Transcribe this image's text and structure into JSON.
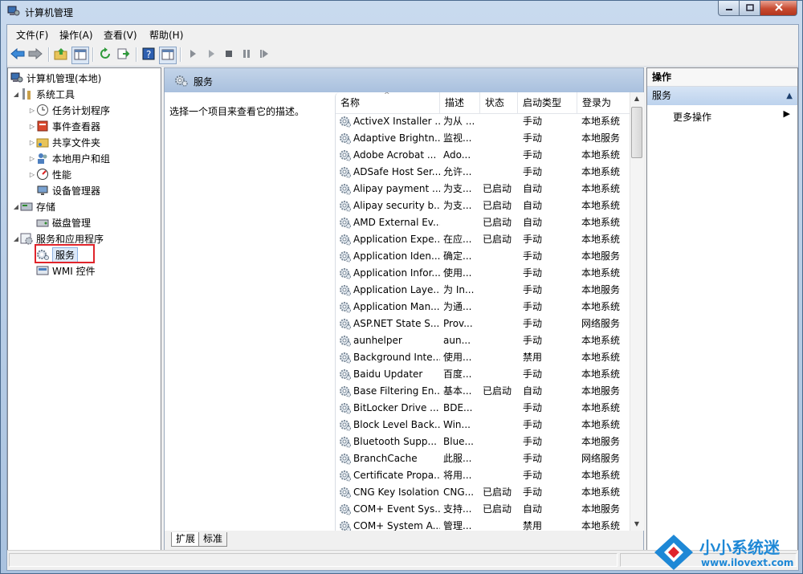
{
  "window": {
    "title": "计算机管理",
    "controls": {
      "minimize": "minimize-icon",
      "maximize": "maximize-icon",
      "close": "close-icon"
    }
  },
  "menubar": [
    "文件(F)",
    "操作(A)",
    "查看(V)",
    "帮助(H)"
  ],
  "toolbar": [
    "back-icon",
    "forward-icon",
    "up-folder-icon",
    "show-hide-tree-icon",
    "refresh-icon",
    "export-icon",
    "help-icon",
    "properties-icon",
    "play-icon",
    "play-outline-icon",
    "stop-icon",
    "pause-icon",
    "restart-icon"
  ],
  "tree": {
    "root": "计算机管理(本地)",
    "items": [
      {
        "label": "系统工具",
        "level": 1,
        "expanded": true,
        "icon": "tools-icon"
      },
      {
        "label": "任务计划程序",
        "level": 2,
        "icon": "clock-icon"
      },
      {
        "label": "事件查看器",
        "level": 2,
        "icon": "event-log-icon"
      },
      {
        "label": "共享文件夹",
        "level": 2,
        "icon": "shared-folder-icon"
      },
      {
        "label": "本地用户和组",
        "level": 2,
        "icon": "users-icon"
      },
      {
        "label": "性能",
        "level": 2,
        "icon": "performance-icon"
      },
      {
        "label": "设备管理器",
        "level": 2,
        "icon": "device-manager-icon"
      },
      {
        "label": "存储",
        "level": 1,
        "expanded": true,
        "icon": "storage-icon"
      },
      {
        "label": "磁盘管理",
        "level": 2,
        "icon": "disk-icon"
      },
      {
        "label": "服务和应用程序",
        "level": 1,
        "expanded": true,
        "icon": "services-apps-icon"
      },
      {
        "label": "服务",
        "level": 2,
        "selected": true,
        "icon": "service-gear-icon"
      },
      {
        "label": "WMI 控件",
        "level": 2,
        "icon": "wmi-icon"
      }
    ]
  },
  "services_panel": {
    "title": "服务",
    "description_hint": "选择一个项目来查看它的描述。",
    "columns": [
      "名称",
      "描述",
      "状态",
      "启动类型",
      "登录为"
    ],
    "rows": [
      [
        "ActiveX Installer ...",
        "为从 ...",
        "",
        "手动",
        "本地系统"
      ],
      [
        "Adaptive Brightn...",
        "监视...",
        "",
        "手动",
        "本地服务"
      ],
      [
        "Adobe Acrobat ...",
        "Ado...",
        "",
        "手动",
        "本地系统"
      ],
      [
        "ADSafe Host Ser...",
        "允许...",
        "",
        "手动",
        "本地系统"
      ],
      [
        "Alipay payment ...",
        "为支...",
        "已启动",
        "自动",
        "本地系统"
      ],
      [
        "Alipay security b...",
        "为支...",
        "已启动",
        "自动",
        "本地系统"
      ],
      [
        "AMD External Ev...",
        "",
        "已启动",
        "自动",
        "本地系统"
      ],
      [
        "Application Expe...",
        "在应...",
        "已启动",
        "手动",
        "本地系统"
      ],
      [
        "Application Iden...",
        "确定...",
        "",
        "手动",
        "本地服务"
      ],
      [
        "Application Infor...",
        "使用...",
        "",
        "手动",
        "本地系统"
      ],
      [
        "Application Laye...",
        "为 In...",
        "",
        "手动",
        "本地服务"
      ],
      [
        "Application Man...",
        "为通...",
        "",
        "手动",
        "本地系统"
      ],
      [
        "ASP.NET State S...",
        "Prov...",
        "",
        "手动",
        "网络服务"
      ],
      [
        "aunhelper",
        "aun...",
        "",
        "手动",
        "本地系统"
      ],
      [
        "Background Inte...",
        "使用...",
        "",
        "禁用",
        "本地系统"
      ],
      [
        "Baidu Updater",
        "百度...",
        "",
        "手动",
        "本地系统"
      ],
      [
        "Base Filtering En...",
        "基本...",
        "已启动",
        "自动",
        "本地服务"
      ],
      [
        "BitLocker Drive ...",
        "BDE...",
        "",
        "手动",
        "本地系统"
      ],
      [
        "Block Level Back...",
        "Win...",
        "",
        "手动",
        "本地系统"
      ],
      [
        "Bluetooth Supp...",
        "Blue...",
        "",
        "手动",
        "本地服务"
      ],
      [
        "BranchCache",
        "此服...",
        "",
        "手动",
        "网络服务"
      ],
      [
        "Certificate Propa...",
        "将用...",
        "",
        "手动",
        "本地系统"
      ],
      [
        "CNG Key Isolation",
        "CNG...",
        "已启动",
        "手动",
        "本地系统"
      ],
      [
        "COM+ Event Sys...",
        "支持...",
        "已启动",
        "自动",
        "本地服务"
      ],
      [
        "COM+ System A...",
        "管理...",
        "",
        "禁用",
        "本地系统"
      ]
    ],
    "tabs": [
      "扩展",
      "标准"
    ]
  },
  "actions_panel": {
    "title": "操作",
    "section": "服务",
    "more": "更多操作"
  },
  "watermark": {
    "brand": "小小系统迷",
    "url": "www.ilovext.com"
  },
  "colors": {
    "accent": "#3a7fcf",
    "highlight_box": "#e0242b",
    "header_blue": "#b7cbe4"
  }
}
